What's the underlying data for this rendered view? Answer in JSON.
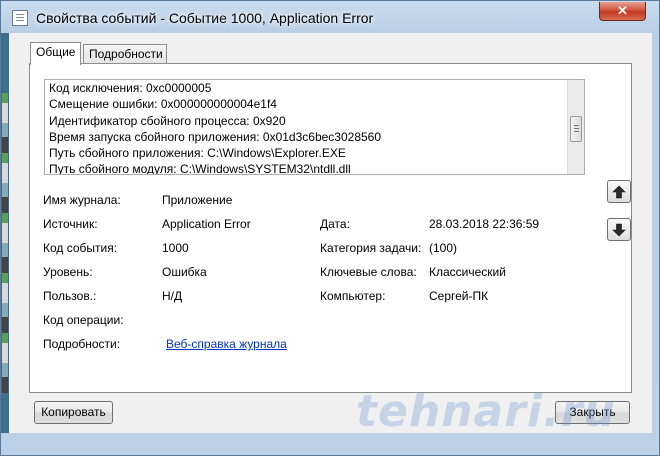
{
  "window": {
    "title": "Свойства событий - Событие 1000, Application Error",
    "close_glyph": "✕"
  },
  "tabs": [
    {
      "label": "Общие",
      "active": true
    },
    {
      "label": "Подробности",
      "active": false
    }
  ],
  "description_lines": [
    "Код исключения: 0xc0000005",
    "Смещение ошибки: 0x000000000004e1f4",
    "Идентификатор сбойного процесса: 0x920",
    "Время запуска сбойного приложения: 0x01d3c6bec3028560",
    "Путь сбойного приложения: C:\\Windows\\Explorer.EXE",
    "Путь сбойного модуля: C:\\Windows\\SYSTEM32\\ntdll.dll"
  ],
  "fields": {
    "log_name": {
      "label": "Имя журнала:",
      "value": "Приложение"
    },
    "source": {
      "label": "Источник:",
      "value": "Application Error"
    },
    "date": {
      "label": "Дата:",
      "value": "28.03.2018 22:36:59"
    },
    "event_id": {
      "label": "Код события:",
      "value": "1000"
    },
    "task_category": {
      "label": "Категория задачи:",
      "value": "(100)"
    },
    "level": {
      "label": "Уровень:",
      "value": "Ошибка"
    },
    "keywords": {
      "label": "Ключевые слова:",
      "value": "Классический"
    },
    "user": {
      "label": "Пользов.:",
      "value": "Н/Д"
    },
    "computer": {
      "label": "Компьютер:",
      "value": "Сергей-ПК"
    },
    "opcode": {
      "label": "Код операции:",
      "value": ""
    },
    "more_info": {
      "label": "Подробности:",
      "link": "Веб-справка журнала"
    }
  },
  "buttons": {
    "copy": "Копировать",
    "close": "Закрыть"
  },
  "icons": {
    "up": "arrow-up-icon",
    "down": "arrow-down-icon"
  },
  "watermark": "tehnari.ru"
}
